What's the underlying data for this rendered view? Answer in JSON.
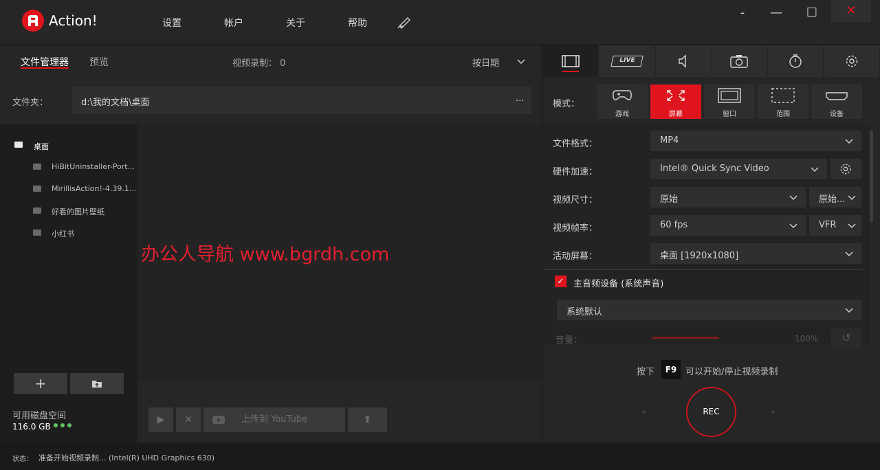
{
  "app": {
    "title": "Action!"
  },
  "menu": {
    "settings": "设置",
    "account": "帐户",
    "about": "关于",
    "help": "帮助"
  },
  "window": {
    "minimize": "-",
    "restore": "—",
    "maximize": "☐",
    "close": "✕"
  },
  "left_tabs": {
    "files": "文件管理器",
    "preview": "预览"
  },
  "recording_count": "视频录制： 0",
  "sort": {
    "label": "按日期"
  },
  "folder": {
    "label": "文件夹：",
    "path": "d:\\我的文档\\桌面",
    "more": "..."
  },
  "tree": {
    "root": "桌面",
    "items": [
      "HiBitUninstaller-Port...",
      "MirillisAction!-4.39.1...",
      "好看的图片壁纸",
      "小红书"
    ]
  },
  "tree_buttons": {
    "add": "+",
    "folder": "⌂"
  },
  "disk": {
    "label": "可用磁盘空间",
    "value": "116.0 GB"
  },
  "actions": {
    "play": "▶",
    "delete": "✕",
    "upload_youtube": "上传到 YouTube",
    "upload": "⬆"
  },
  "watermark": "办公人导航  www.bgrdh.com",
  "right_tabs": [
    "video",
    "live",
    "audio",
    "screenshot",
    "timer",
    "settings"
  ],
  "live_label": "LIVE",
  "mode": {
    "label": "模式：",
    "options": [
      "游戏",
      "屏幕",
      "窗口",
      "范围",
      "设备"
    ],
    "selected": "屏幕"
  },
  "settings": {
    "format": {
      "label": "文件格式：",
      "value": "MP4"
    },
    "hwaccel": {
      "label": "硬件加速：",
      "value": "Intel® Quick Sync Video"
    },
    "size": {
      "label": "视频尺寸：",
      "value": "原始",
      "value2": "原始..."
    },
    "fps": {
      "label": "视频帧率：",
      "value": "60 fps",
      "value2": "VFR"
    },
    "screen": {
      "label": "活动屏幕：",
      "value": "桌面 [1920x1080]"
    },
    "audio": {
      "label": "主音频设备 (系统声音)",
      "checked": true,
      "device": "系统默认"
    },
    "volume": {
      "label": "音量：",
      "value": "100%",
      "level": 1.0
    }
  },
  "hotkey": {
    "prefix": "按下",
    "key": "F9",
    "suffix": "可以开始/停止视频录制"
  },
  "rec": {
    "label": "REC"
  },
  "status": {
    "label": "状态：",
    "text": "准备开始视频录制... (Intel(R) UHD Graphics 630)"
  },
  "colors": {
    "accent": "#e0141e",
    "bg": "#1f1f1f",
    "panel": "#262626"
  }
}
